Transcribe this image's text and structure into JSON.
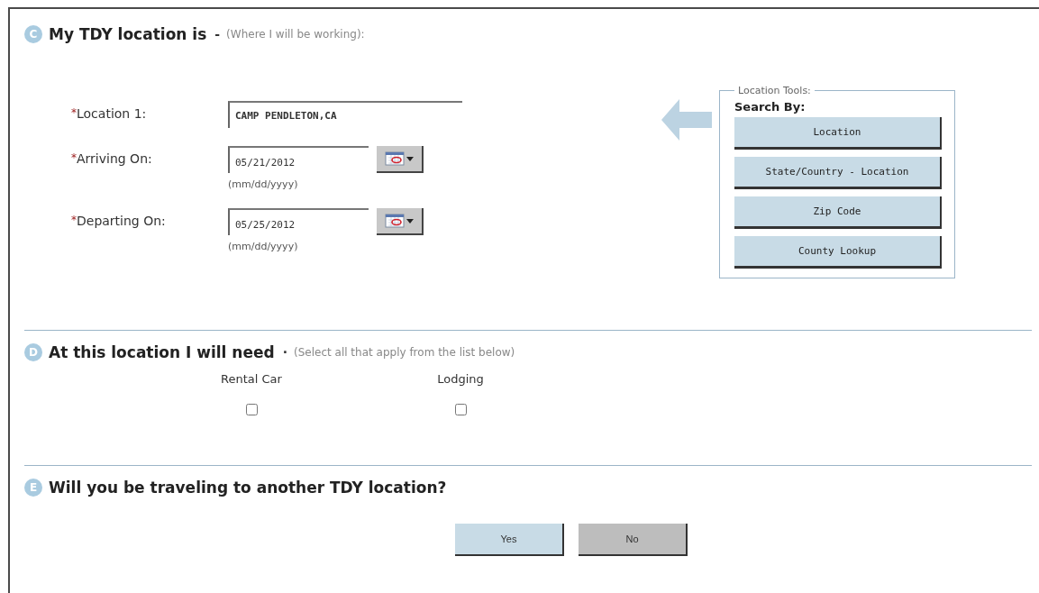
{
  "sections": [
    {
      "kind": "location",
      "letter": "C",
      "title": "My TDY location is",
      "note": "(Where I will be working):",
      "separator": "-",
      "fields": [
        {
          "kind": "text",
          "label": "Location 1:",
          "mark": "*",
          "value": "CAMP PENDLETON,CA"
        },
        {
          "kind": "date",
          "label": "Arriving On:",
          "mark": "*",
          "value": "05/21/2012",
          "hint": "(mm/dd/yyyy)"
        },
        {
          "kind": "date",
          "label": "Departing On:",
          "mark": "*",
          "value": "05/25/2012",
          "hint": "(mm/dd/yyyy)"
        }
      ],
      "tools": {
        "legend": "Location Tools:",
        "heading": "Search By:",
        "buttons": [
          "Location",
          "State/Country - Location",
          "Zip Code",
          "County Lookup"
        ]
      }
    },
    {
      "kind": "needs",
      "letter": "D",
      "title": "At this location I will need",
      "note": "(Select all that apply from the list below)",
      "separator": "·",
      "options": [
        {
          "label": "Rental Car",
          "checked": false
        },
        {
          "label": "Lodging",
          "checked": false
        }
      ]
    },
    {
      "kind": "question",
      "letter": "E",
      "title": "Will you be traveling to another TDY location?",
      "answers": [
        {
          "label": "Yes",
          "selected": true
        },
        {
          "label": "No",
          "selected": false
        }
      ]
    }
  ]
}
